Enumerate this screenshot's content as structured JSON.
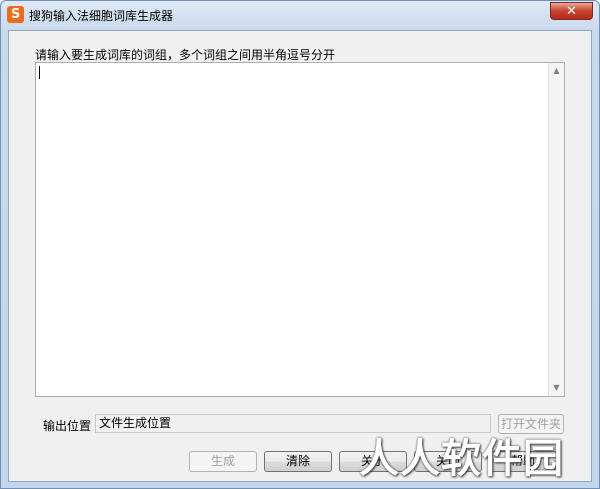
{
  "window": {
    "title": "搜狗输入法细胞词库生成器",
    "app_icon_glyph": "S",
    "close_glyph": "✕"
  },
  "main": {
    "prompt": "请输入要生成词库的词组，多个词组之间用半角逗号分开",
    "textarea_value": "",
    "scroll_up_glyph": "▲",
    "scroll_down_glyph": "▼"
  },
  "output": {
    "label": "输出位置",
    "value": "文件生成位置",
    "open_folder_label": "打开文件夹"
  },
  "buttons": {
    "generate": "生成",
    "clear": "清除",
    "about": "关于",
    "close": "关闭",
    "help": "帮助"
  },
  "watermark": "人人软件园",
  "colors": {
    "accent_icon": "#f06b1f",
    "close_button": "#c7442f",
    "title_bar": "#c9d9ec"
  }
}
